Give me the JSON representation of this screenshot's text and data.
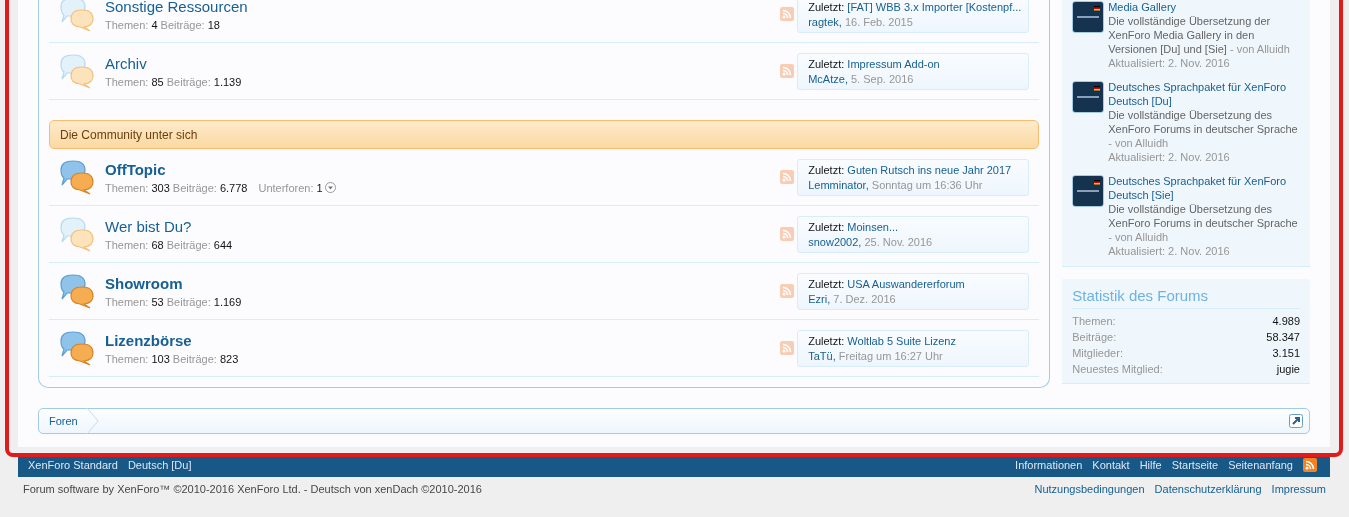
{
  "forum_list": [
    {
      "kind": "forum",
      "title": "Sonstige Ressourcen",
      "unread": false,
      "threads_label": "Themen:",
      "threads": "4",
      "posts_label": "Beiträge:",
      "posts": "18",
      "last_label": "Zuletzt:",
      "last_title": "[FAT] WBB 3.x Importer [Kostenpf...",
      "last_user": "ragtek,",
      "last_date": "16. Feb. 2015"
    },
    {
      "kind": "forum",
      "title": "Archiv",
      "unread": false,
      "threads_label": "Themen:",
      "threads": "85",
      "posts_label": "Beiträge:",
      "posts": "1.139",
      "last_label": "Zuletzt:",
      "last_title": "Impressum Add-on",
      "last_user": "McAtze,",
      "last_date": "5. Sep. 2016"
    },
    {
      "kind": "category",
      "title": "Die Community unter sich"
    },
    {
      "kind": "forum",
      "title": "OffTopic",
      "unread": true,
      "threads_label": "Themen:",
      "threads": "303",
      "posts_label": "Beiträge:",
      "posts": "6.778",
      "subforums_label": "Unterforen:",
      "subforums": "1",
      "last_label": "Zuletzt:",
      "last_title": "Guten Rutsch ins neue Jahr 2017",
      "last_user": "Lemminator,",
      "last_date": "Sonntag um 16:36 Uhr"
    },
    {
      "kind": "forum",
      "title": "Wer bist Du?",
      "unread": false,
      "threads_label": "Themen:",
      "threads": "68",
      "posts_label": "Beiträge:",
      "posts": "644",
      "last_label": "Zuletzt:",
      "last_title": "Moinsen...",
      "last_user": "snow2002,",
      "last_date": "25. Nov. 2016"
    },
    {
      "kind": "forum",
      "title": "Showroom",
      "unread": true,
      "threads_label": "Themen:",
      "threads": "53",
      "posts_label": "Beiträge:",
      "posts": "1.169",
      "last_label": "Zuletzt:",
      "last_title": "USA Auswandererforum",
      "last_user": "Ezri,",
      "last_date": "7. Dez. 2016"
    },
    {
      "kind": "forum",
      "title": "Lizenzbörse",
      "unread": true,
      "threads_label": "Themen:",
      "threads": "103",
      "posts_label": "Beiträge:",
      "posts": "823",
      "last_label": "Zuletzt:",
      "last_title": "Woltlab 5 Suite Lizenz",
      "last_user": "TaTü,",
      "last_date": "Freitag um 16:27 Uhr"
    }
  ],
  "sidebar": {
    "resources": [
      {
        "title": "Media Gallery",
        "description": "Die vollständige Übersetzung der XenForo Media Gallery in den Versionen [Du] und [Sie]",
        "author": "- von Alluidh",
        "updated": "Aktualisiert: 2. Nov. 2016"
      },
      {
        "title": "Deutsches Sprachpaket für XenForo Deutsch [Du]",
        "description": "Die vollständige Übersetzung des XenForo Forums in deutscher Sprache",
        "author": "- von Alluidh",
        "updated": "Aktualisiert: 2. Nov. 2016"
      },
      {
        "title": "Deutsches Sprachpaket für XenForo Deutsch [Sie]",
        "description": "Die vollständige Übersetzung des XenForo Forums in deutscher Sprache",
        "author": "- von Alluidh",
        "updated": "Aktualisiert: 2. Nov. 2016"
      }
    ],
    "stats": {
      "title": "Statistik des Forums",
      "rows": [
        {
          "label": "Themen:",
          "value": "4.989"
        },
        {
          "label": "Beiträge:",
          "value": "58.347"
        },
        {
          "label": "Mitglieder:",
          "value": "3.151"
        },
        {
          "label": "Neuestes Mitglied:",
          "value": "jugie"
        }
      ]
    }
  },
  "breadcrumb": [
    "Foren"
  ],
  "footer": {
    "left": [
      "XenForo Standard",
      "Deutsch [Du]"
    ],
    "right": [
      "Informationen",
      "Kontakt",
      "Hilfe",
      "Startseite",
      "Seitenanfang"
    ]
  },
  "copyright": "Forum software by XenForo™ ©2010-2016 XenForo Ltd. - Deutsch von xenDach ©2010-2016",
  "legal_links": [
    "Nutzungsbedingungen",
    "Datenschutzerklärung",
    "Impressum"
  ]
}
